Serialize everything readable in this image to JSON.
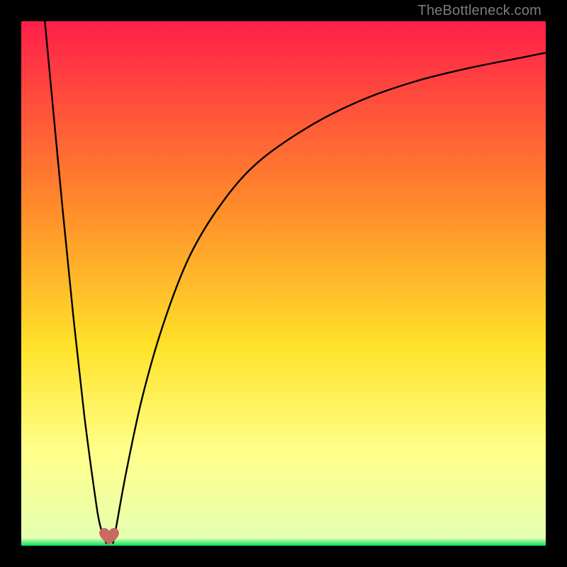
{
  "watermark": "TheBottleneck.com",
  "colors": {
    "frame": "#000000",
    "gradient_top": "#ff1f4a",
    "gradient_mid1": "#ff8a2a",
    "gradient_mid2": "#ffe22a",
    "gradient_mid3": "#ffff8a",
    "gradient_bottom": "#00e060",
    "curve": "#000000",
    "heart": "#c76a61"
  },
  "chart_data": {
    "type": "line",
    "title": "",
    "xlabel": "",
    "ylabel": "",
    "xlim": [
      0,
      100
    ],
    "ylim": [
      0,
      100
    ],
    "grid": false,
    "legend": false,
    "series": [
      {
        "name": "left-branch",
        "x": [
          4.5,
          6,
          8,
          10,
          12,
          14,
          15,
          16.2
        ],
        "values": [
          100,
          84,
          63,
          43,
          25,
          10,
          4,
          0.5
        ]
      },
      {
        "name": "right-branch",
        "x": [
          17.5,
          18,
          20,
          23,
          27,
          32,
          38,
          45,
          55,
          65,
          75,
          85,
          95,
          100
        ],
        "values": [
          0.5,
          3,
          14,
          28,
          42,
          55,
          65,
          73,
          80,
          85,
          88.5,
          91,
          93,
          94
        ]
      }
    ],
    "marker": {
      "name": "heart-marker",
      "x": 16.8,
      "y": 0.5
    },
    "gradient_stops": [
      {
        "offset": 0.0,
        "color": "#ff1f4a"
      },
      {
        "offset": 0.35,
        "color": "#ff8a2a"
      },
      {
        "offset": 0.62,
        "color": "#ffe22a"
      },
      {
        "offset": 0.82,
        "color": "#ffff8a"
      },
      {
        "offset": 0.985,
        "color": "#e6ffb0"
      },
      {
        "offset": 1.0,
        "color": "#00e060"
      }
    ]
  }
}
